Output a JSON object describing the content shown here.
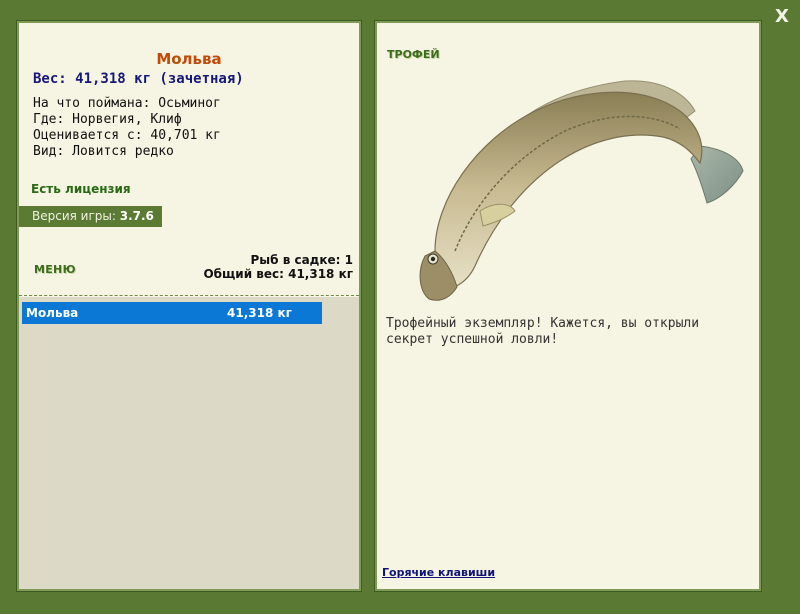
{
  "close_label": "X",
  "left": {
    "fish_name": "Мольва",
    "weight_line": "Вес: 41,318 кг (зачетная)",
    "caught_on": "На что поймана: Осьминог",
    "location": "Где: Норвегия, Клиф",
    "rated_from": "Оценивается с: 40,701 кг",
    "kind": "Вид: Ловится редко",
    "license": "Есть лицензия",
    "version_label": "Версия игры: ",
    "version_value": "3.7.6",
    "menu_label": "МЕНЮ",
    "fish_count": "Рыб в садке: 1",
    "total_weight": "Общий вес: 41,318 кг",
    "list": [
      {
        "name": "Мольва",
        "weight": "41,318 кг"
      }
    ]
  },
  "right": {
    "trophy_label": "ТРОФЕЙ",
    "description": "Трофейный экземпляр! Кажется, вы открыли секрет успешной ловли!",
    "hotkeys": "Горячие клавиши"
  },
  "colors": {
    "background": "#5a7a34",
    "panel": "#f6f4e3",
    "fish_name": "#c04a08",
    "weight": "#17187c",
    "selection": "#0b78d6"
  }
}
